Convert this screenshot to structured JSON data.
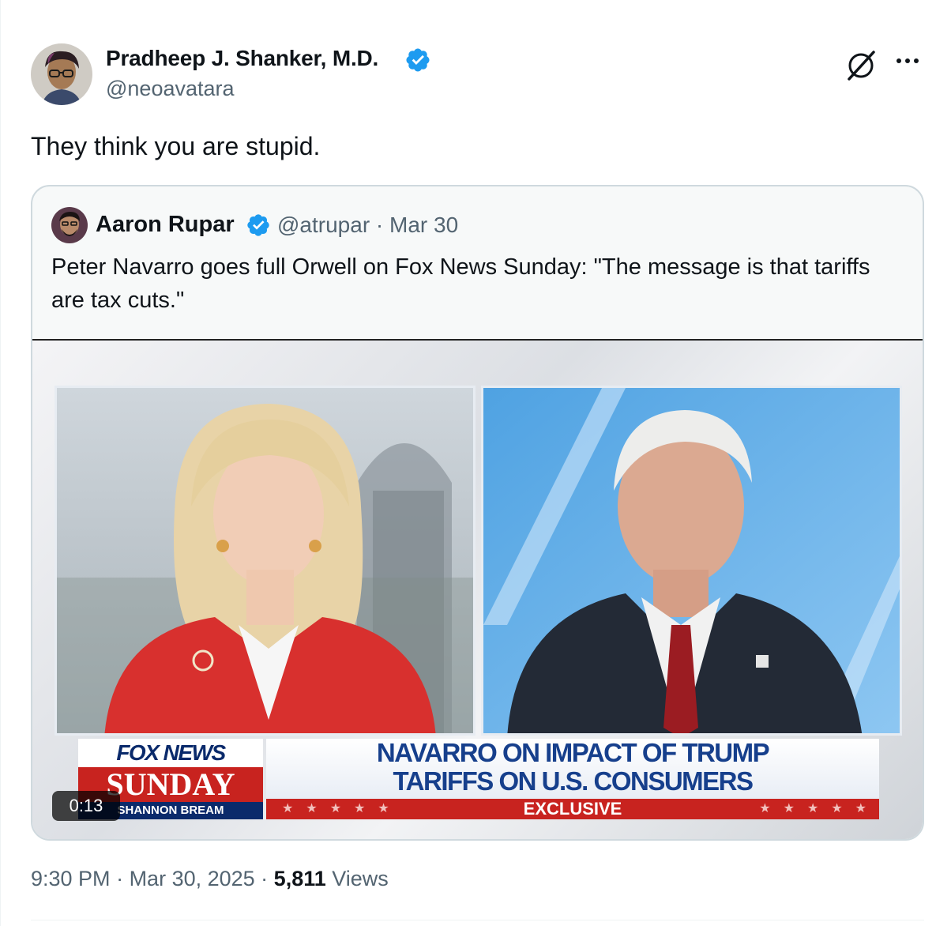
{
  "author": {
    "name": "Pradheep J. Shanker, M.D.",
    "handle": "@neoavatara",
    "avatar_icon": "avatar-photo-boy-with-glasses",
    "verified_icon": "verified-badge-icon",
    "verified_color": "#1d9bf0"
  },
  "header_actions": {
    "grok_icon": "grok-icon",
    "more_icon": "more-dots-icon"
  },
  "tweet_text": "They think you are stupid.",
  "quoted_tweet": {
    "name": "Aaron Rupar",
    "handle": "@atrupar",
    "separator": "·",
    "date": "Mar 30",
    "text": "Peter Navarro goes full Orwell on Fox News Sunday: \"The message is that tariffs are tax cuts.\"",
    "video": {
      "duration": "0:13",
      "show_logo_top": "FOX NEWS",
      "show_logo_mid": "SUNDAY",
      "show_logo_bottom": "SHANNON BREAM",
      "headline_line1": "NAVARRO ON IMPACT OF TRUMP",
      "headline_line2": "TARIFFS ON U.S. CONSUMERS",
      "banner": "EXCLUSIVE",
      "stars_left": "★★★★★",
      "stars_right": "★★★★★"
    }
  },
  "footer": {
    "time": "9:30 PM",
    "sep1": " · ",
    "date": "Mar 30, 2025",
    "sep2": " · ",
    "views_count": "5,811",
    "views_label": " Views"
  },
  "colors": {
    "text_primary": "#0f1419",
    "text_secondary": "#536471",
    "border": "#cfd9de",
    "fox_red": "#c8231f",
    "fox_navy": "#0a2a6b"
  }
}
